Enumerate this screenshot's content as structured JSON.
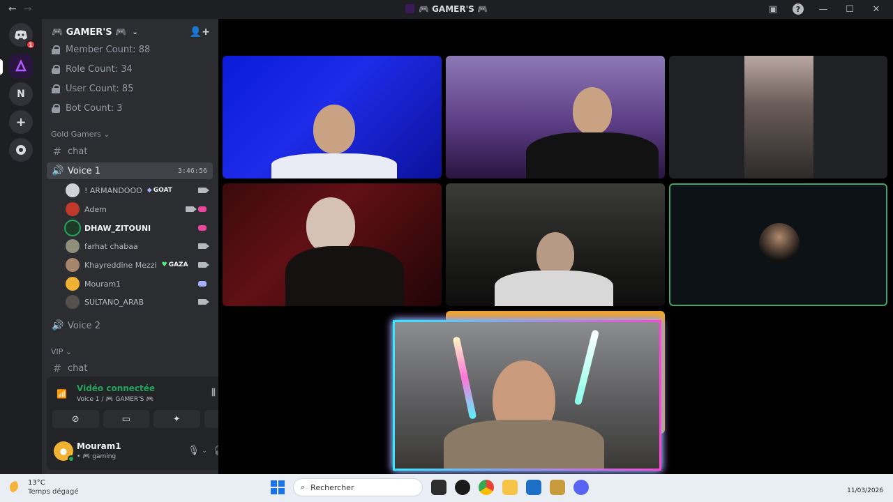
{
  "window": {
    "title": "🎮 GAMER'S 🎮",
    "nav_back": "←",
    "nav_forward": "→",
    "help": "?",
    "minimize": "—",
    "maximize": "☐",
    "close": "✕"
  },
  "rail": {
    "home_badge": "1",
    "n_label": "N",
    "add_label": "+"
  },
  "server": {
    "name": "🎮 GAMER'S 🎮",
    "stats": [
      "Member Count: 88",
      "Role Count: 34",
      "User Count: 85",
      "Bot Count: 3"
    ],
    "categories": {
      "gold": "Gold Gamers ⌄",
      "vip": "VIP ⌄"
    },
    "channels": {
      "chat1": "chat",
      "voice1": "Voice 1",
      "voice1_timer": "3:46:56",
      "voice2": "Voice 2",
      "chat2": "chat"
    },
    "voice_users": [
      {
        "name": "! ARMANDOOO",
        "tag": "GOAT"
      },
      {
        "name": "Adem",
        "tag": ""
      },
      {
        "name": "DHAW_ZITOUNI",
        "tag": ""
      },
      {
        "name": "farhat chabaa",
        "tag": ""
      },
      {
        "name": "Khayreddine Mezzi",
        "tag": "GAZA"
      },
      {
        "name": "Mouram1",
        "tag": ""
      },
      {
        "name": "SULTANO_ARAB",
        "tag": ""
      }
    ]
  },
  "voice_panel": {
    "title": "Vidéo connectée",
    "subtitle": "Voice 1 / 🎮 GAMER'S 🎮"
  },
  "user_panel": {
    "name": "Mouram1",
    "status": "• 🎮 gaming"
  },
  "taskbar": {
    "temp": "13°C",
    "weather": "Temps dégagé",
    "search_placeholder": "Rechercher",
    "date": "11/03/2026"
  },
  "colors": {
    "accent_green": "#23a55a",
    "discord_orange": "#f0a82a",
    "sidebar_bg": "#2b2d31",
    "rail_bg": "#1e1f22"
  }
}
